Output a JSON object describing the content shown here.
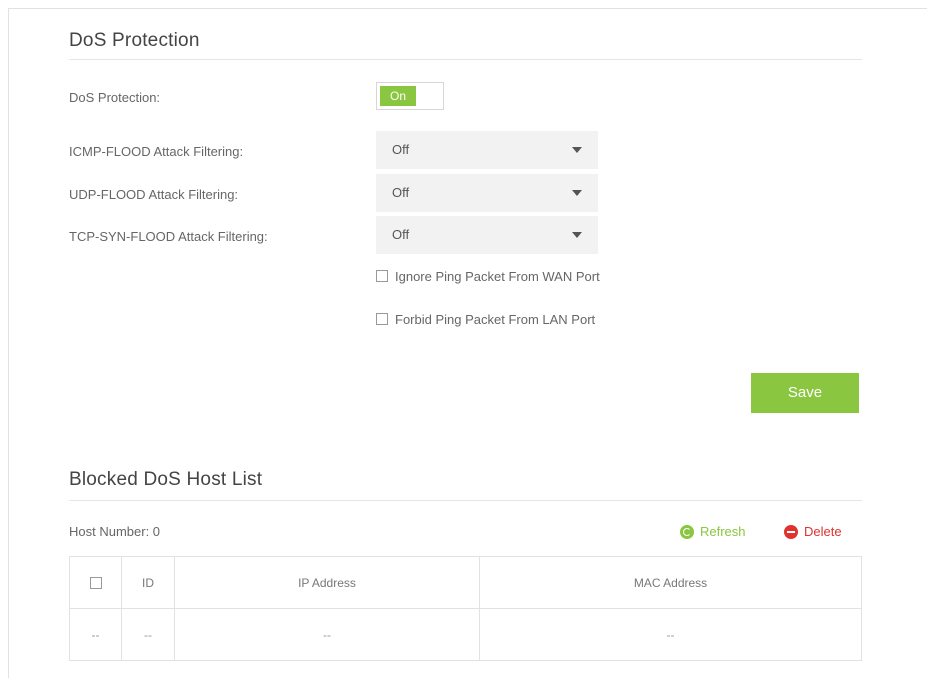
{
  "dos_section": {
    "title": "DoS Protection",
    "protection_label": "DoS Protection:",
    "toggle_value": "On",
    "icmp_label": "ICMP-FLOOD Attack Filtering:",
    "icmp_value": "Off",
    "udp_label": "UDP-FLOOD Attack Filtering:",
    "udp_value": "Off",
    "tcp_label": "TCP-SYN-FLOOD Attack Filtering:",
    "tcp_value": "Off",
    "ignore_ping_label": "Ignore Ping Packet From WAN Port",
    "forbid_ping_label": "Forbid Ping Packet From LAN Port",
    "save_label": "Save"
  },
  "blocked_section": {
    "title": "Blocked DoS Host List",
    "host_number": "Host Number: 0",
    "refresh_label": "Refresh",
    "delete_label": "Delete",
    "columns": [
      "ID",
      "IP Address",
      "MAC Address"
    ],
    "rows": [
      {
        "id": "--",
        "ip": "--",
        "mac": "--",
        "blank": "--"
      }
    ]
  },
  "colors": {
    "accent_green": "#8ac640",
    "delete_red": "#e0322e"
  }
}
